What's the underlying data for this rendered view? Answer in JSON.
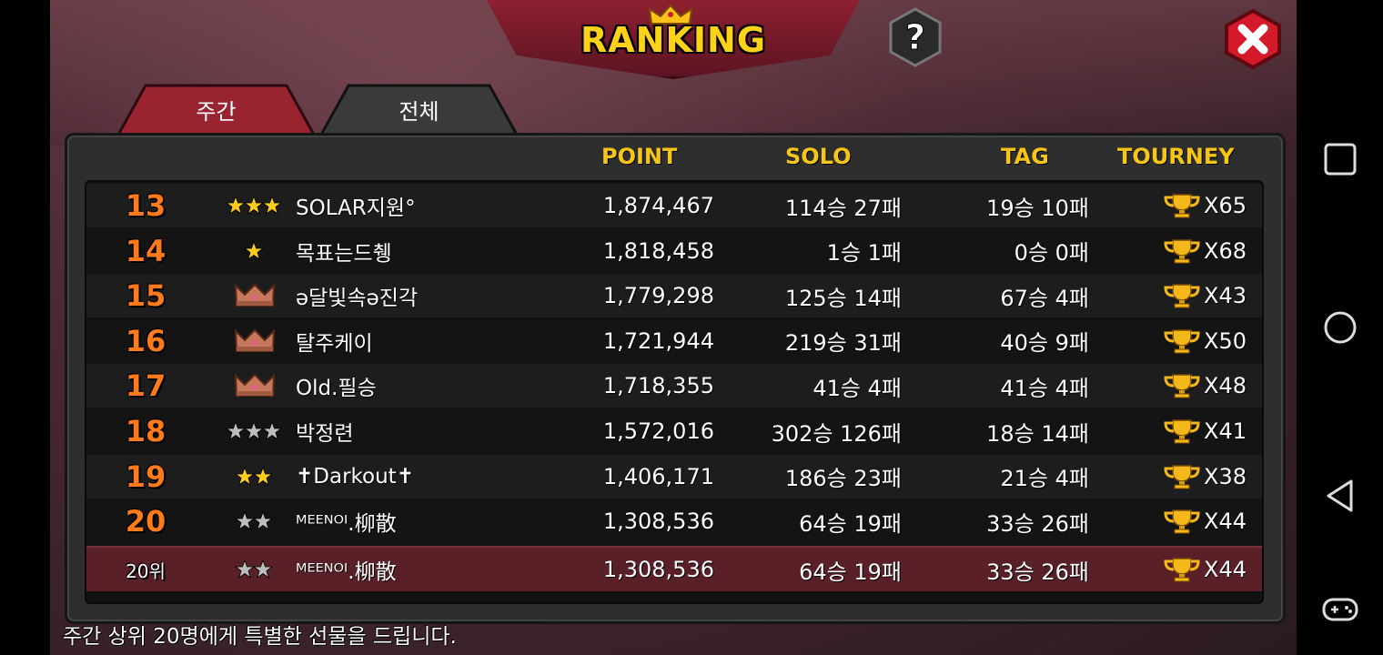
{
  "header": {
    "title": "RANKING"
  },
  "tabs": [
    {
      "label": "주간",
      "active": true
    },
    {
      "label": "전체",
      "active": false
    }
  ],
  "columns": {
    "point": "POINT",
    "solo": "SOLO",
    "tag": "TAG",
    "tourney": "TOURNEY"
  },
  "rows": [
    {
      "rank": "13",
      "badge": "gold-stars-3",
      "name": "SOLAR지원°",
      "point": "1,874,467",
      "solo": "114승 27패",
      "tag": "19승 10패",
      "tourney": "X65"
    },
    {
      "rank": "14",
      "badge": "gold-stars-1",
      "name": "목표는드췡",
      "point": "1,818,458",
      "solo": "1승 1패",
      "tag": "0승 0패",
      "tourney": "X68"
    },
    {
      "rank": "15",
      "badge": "bronze-crown",
      "name": "ə달빛속ə진각",
      "point": "1,779,298",
      "solo": "125승 14패",
      "tag": "67승 4패",
      "tourney": "X43"
    },
    {
      "rank": "16",
      "badge": "bronze-crown",
      "name": "탈주케이",
      "point": "1,721,944",
      "solo": "219승 31패",
      "tag": "40승 9패",
      "tourney": "X50"
    },
    {
      "rank": "17",
      "badge": "bronze-crown",
      "name": "Old.필승",
      "point": "1,718,355",
      "solo": "41승 4패",
      "tag": "41승 4패",
      "tourney": "X48"
    },
    {
      "rank": "18",
      "badge": "silver-stars-3",
      "name": "박정련",
      "point": "1,572,016",
      "solo": "302승 126패",
      "tag": "18승 14패",
      "tourney": "X41"
    },
    {
      "rank": "19",
      "badge": "gold-stars-2",
      "name": "✝Darkout✝",
      "point": "1,406,171",
      "solo": "186승 23패",
      "tag": "21승 4패",
      "tourney": "X38"
    },
    {
      "rank": "20",
      "badge": "silver-stars-2",
      "name": "ᴹᴱᴱᴺᴼᴵ.柳散",
      "point": "1,308,536",
      "solo": "64승 19패",
      "tag": "33승 26패",
      "tourney": "X44"
    }
  ],
  "my_row": {
    "rank": "20위",
    "badge": "silver-stars-2",
    "name": "ᴹᴱᴱᴺᴼᴵ.柳散",
    "point": "1,308,536",
    "solo": "64승 19패",
    "tag": "33승 26패",
    "tourney": "X44"
  },
  "footer": {
    "text": "주간 상위 20명에게 특별한 선물을 드립니다."
  },
  "colors": {
    "accent_gold": "#f5c518",
    "rank_orange": "#ff7a1a",
    "banner_red": "#8e2030",
    "my_row_bg": "#5a2027"
  }
}
